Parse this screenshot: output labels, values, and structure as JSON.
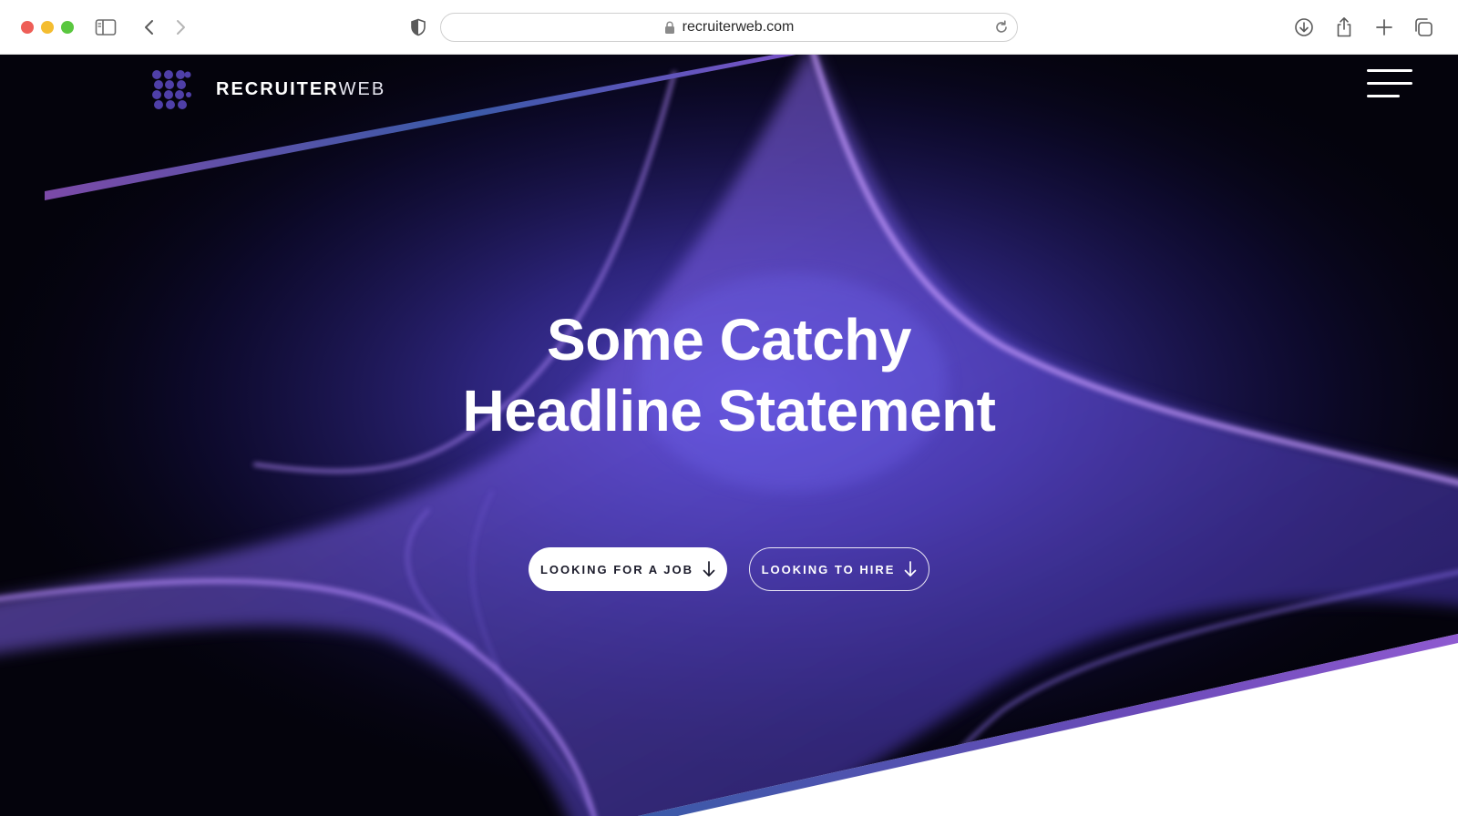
{
  "browser": {
    "url": "recruiterweb.com",
    "buttons": [
      "sidebar-toggle",
      "back",
      "forward",
      "privacy-shield",
      "reload",
      "downloads",
      "share",
      "new-tab",
      "tab-overview"
    ]
  },
  "site": {
    "brand_strong": "RECRUITER",
    "brand_light": "WEB",
    "logo_icon": "dot-grid-logo",
    "menu_icon": "hamburger-menu-icon"
  },
  "hero": {
    "headline_line1": "Some Catchy",
    "headline_line2": "Headline Statement",
    "cta_job_label": "LOOKING FOR A JOB",
    "cta_hire_label": "LOOKING TO HIRE",
    "cta_icon": "arrow-down-icon"
  },
  "colors": {
    "accent_purple": "#7a4fe0",
    "deep_navy": "#04030c",
    "stripe_gradient_start": "#7c4aa8",
    "stripe_gradient_mid": "#3a5aa8"
  }
}
